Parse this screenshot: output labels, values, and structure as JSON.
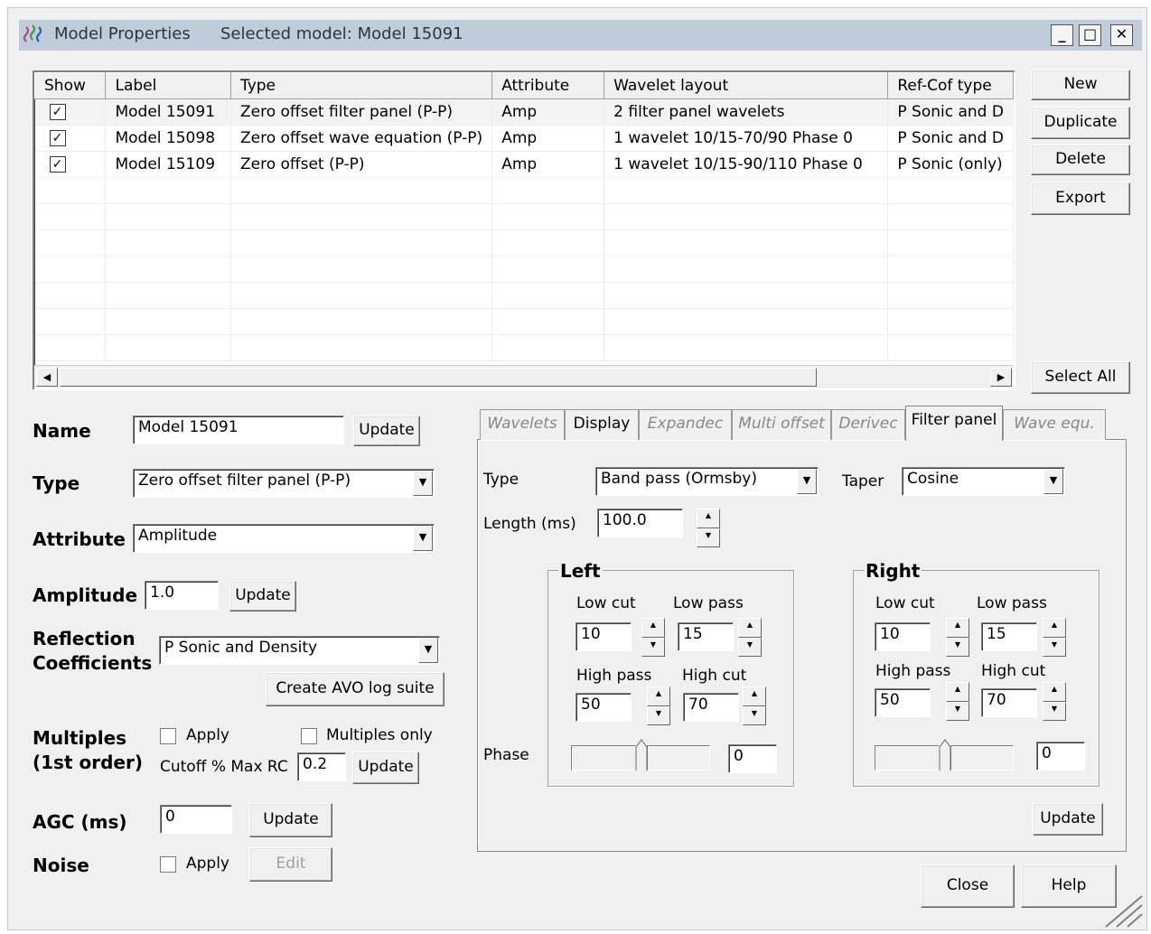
{
  "window": {
    "title": "Model Properties",
    "selected": "Selected model: Model 15091"
  },
  "table": {
    "columns": [
      "Show",
      "Label",
      "Type",
      "Attribute",
      "Wavelet layout",
      "Ref-Cof type"
    ],
    "rows": [
      {
        "show": true,
        "label": "Model 15091",
        "type": "Zero offset filter panel (P-P)",
        "attribute": "Amp",
        "wavelet": "2  filter panel wavelets",
        "refcof": "P Sonic and D"
      },
      {
        "show": true,
        "label": "Model 15098",
        "type": "Zero offset wave equation (P-P)",
        "attribute": "Amp",
        "wavelet": "1  wavelet  10/15-70/90  Phase 0",
        "refcof": "P Sonic and D"
      },
      {
        "show": true,
        "label": "Model 15109",
        "type": "Zero offset (P-P)",
        "attribute": "Amp",
        "wavelet": "1  wavelet  10/15-90/110  Phase 0",
        "refcof": "P Sonic (only)"
      }
    ]
  },
  "side_buttons": {
    "new": "New",
    "duplicate": "Duplicate",
    "delete": "Delete",
    "export": "Export",
    "select_all": "Select All"
  },
  "form": {
    "name_label": "Name",
    "name_value": "Model 15091",
    "update": "Update",
    "type_label": "Type",
    "type_value": "Zero offset filter panel (P-P)",
    "attribute_label": "Attribute",
    "attribute_value": "Amplitude",
    "amplitude_label": "Amplitude",
    "amplitude_value": "1.0",
    "reflection_label1": "Reflection",
    "reflection_label2": "Coefficients",
    "reflection_value": "P Sonic and Density",
    "create_avo": "Create AVO log suite",
    "multiples_label1": "Multiples",
    "multiples_label2": "(1st order)",
    "apply": "Apply",
    "multiples_only": "Multiples only",
    "cutoff_label": "Cutoff % Max RC",
    "cutoff_value": "0.2",
    "agc_label": "AGC (ms)",
    "agc_value": "0",
    "noise_label": "Noise",
    "edit": "Edit"
  },
  "tabs": [
    "Wavelets",
    "Display",
    "Expandec",
    "Multi offset",
    "Derivec",
    "Filter panel",
    "Wave equ."
  ],
  "filter": {
    "type_label": "Type",
    "type_value": "Band pass (Ormsby)",
    "taper_label": "Taper",
    "taper_value": "Cosine",
    "length_label": "Length (ms)",
    "length_value": "100.0",
    "left_title": "Left",
    "right_title": "Right",
    "low_cut": "Low cut",
    "low_pass": "Low pass",
    "high_pass": "High pass",
    "high_cut": "High cut",
    "left": {
      "low_cut": "10",
      "low_pass": "15",
      "high_pass": "50",
      "high_cut": "70",
      "phase": "0"
    },
    "right": {
      "low_cut": "10",
      "low_pass": "15",
      "high_pass": "50",
      "high_cut": "70",
      "phase": "0"
    },
    "phase_label": "Phase",
    "update": "Update"
  },
  "footer": {
    "close": "Close",
    "help": "Help"
  }
}
